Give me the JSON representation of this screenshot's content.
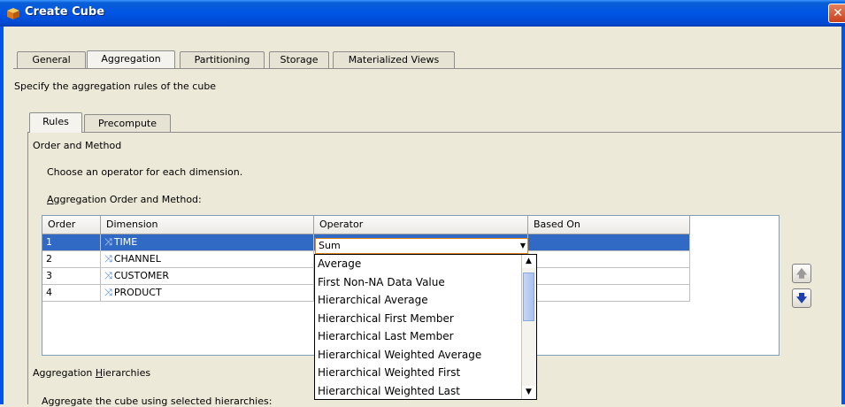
{
  "window": {
    "title": "Create Cube",
    "close_glyph": "✕"
  },
  "main_tabs": [
    {
      "label": "General",
      "active": false
    },
    {
      "label": "Aggregation",
      "active": true
    },
    {
      "label": "Partitioning",
      "active": false
    },
    {
      "label": "Storage",
      "active": false
    },
    {
      "label": "Materialized Views",
      "active": false
    }
  ],
  "description": "Specify the aggregation rules of the cube",
  "sub_tabs": [
    {
      "label": "Rules",
      "active": true
    },
    {
      "label": "Precompute",
      "active": false
    }
  ],
  "order_method": {
    "section_title": "Order and Method",
    "instruction": "Choose an operator for each dimension.",
    "table_label_mnemonic": "A",
    "table_label_rest": "ggregation Order and Method:",
    "columns": [
      "Order",
      "Dimension",
      "Operator",
      "Based On"
    ],
    "rows": [
      {
        "order": "1",
        "dimension": "TIME",
        "operator": "Sum",
        "selected": true
      },
      {
        "order": "2",
        "dimension": "CHANNEL",
        "operator": "",
        "selected": false
      },
      {
        "order": "3",
        "dimension": "CUSTOMER",
        "operator": "",
        "selected": false
      },
      {
        "order": "4",
        "dimension": "PRODUCT",
        "operator": "",
        "selected": false
      }
    ]
  },
  "operator_combo": {
    "value": "Sum",
    "options": [
      "Average",
      "First Non-NA Data Value",
      "Hierarchical Average",
      "Hierarchical First Member",
      "Hierarchical Last Member",
      "Hierarchical Weighted Average",
      "Hierarchical Weighted First",
      "Hierarchical Weighted Last"
    ]
  },
  "hierarchies": {
    "title_prefix": "Aggregation ",
    "title_mnemonic": "H",
    "title_rest": "ierarchies",
    "instruction": "Aggregate the cube using selected hierarchies:"
  },
  "side_buttons": {
    "up": "move-up-icon",
    "down": "move-down-icon"
  },
  "colors": {
    "titlebar": "#0055e5",
    "selection": "#316ac5",
    "combo_border": "#e08a1e"
  }
}
